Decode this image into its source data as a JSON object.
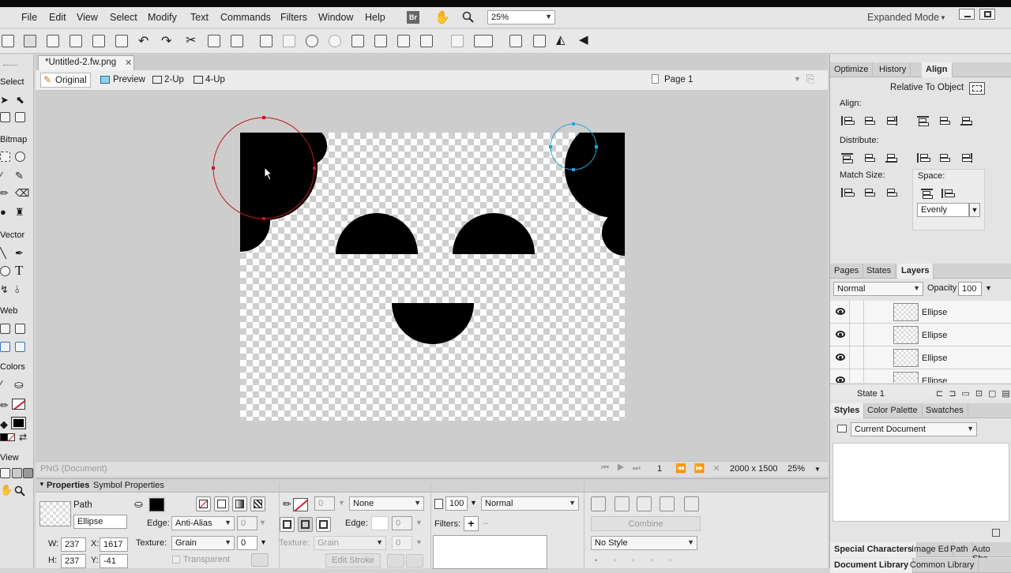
{
  "menubar": {
    "items": [
      "File",
      "Edit",
      "View",
      "Select",
      "Modify",
      "Text",
      "Commands",
      "Filters",
      "Window",
      "Help"
    ],
    "bridge_badge": "Br",
    "zoom": "25%",
    "mode": "Expanded Mode"
  },
  "left_toolbar": {
    "sections": [
      "Select",
      "Bitmap",
      "Vector",
      "Web",
      "Colors",
      "View"
    ],
    "text_tool": "T"
  },
  "document": {
    "tab_title": "*Untitled-2.fw.png",
    "views": {
      "original": "Original",
      "preview": "Preview",
      "two_up": "2-Up",
      "four_up": "4-Up"
    },
    "page": "Page 1",
    "status_type": "PNG (Document)",
    "page_number": "1",
    "dimensions": "2000 x 1500",
    "zoom": "25%"
  },
  "properties": {
    "tabs": [
      "Properties",
      "Symbol Properties"
    ],
    "object_type": "Path",
    "object_name": "Ellipse",
    "fill_edge_label": "Edge:",
    "fill_edge_value": "Anti-Alias",
    "fill_edge_amount": "0",
    "texture_label": "Texture:",
    "texture_value": "Grain",
    "texture_amount": "0",
    "transparent_label": "Transparent",
    "stroke_size": "0",
    "stroke_category": "None",
    "stroke_edge_label": "Edge:",
    "stroke_edge_amount": "0",
    "stroke_texture_label": "Texture:",
    "stroke_texture_value": "Grain",
    "stroke_texture_amount": "0",
    "edit_stroke": "Edit Stroke",
    "opacity": "100",
    "blend_mode": "Normal",
    "filters_label": "Filters:",
    "combine": "Combine",
    "style": "No Style",
    "w_label": "W:",
    "w_value": "237",
    "h_label": "H:",
    "h_value": "237",
    "x_label": "X:",
    "x_value": "1617",
    "y_label": "Y:",
    "y_value": "-41"
  },
  "align_panel": {
    "tabs": [
      "Optimize",
      "History",
      "Align"
    ],
    "relative_to": "Relative To Object",
    "align_label": "Align:",
    "distribute_label": "Distribute:",
    "match_size_label": "Match Size:",
    "space_label": "Space:",
    "space_value": "Evenly"
  },
  "layers_panel": {
    "tabs": [
      "Pages",
      "States",
      "Layers"
    ],
    "blend": "Normal",
    "opacity_label": "Opacity",
    "opacity_value": "100",
    "layers": [
      "Ellipse",
      "Ellipse",
      "Ellipse",
      "Ellipse"
    ],
    "state": "State 1"
  },
  "styles_panel": {
    "tabs": [
      "Styles",
      "Color Palette",
      "Swatches"
    ],
    "library": "Current Document"
  },
  "bottom_tabs": {
    "row1": [
      "Special Characters",
      "Image Ed",
      "Path",
      "Auto Sha"
    ],
    "row2": [
      "Document Library",
      "Common Library"
    ]
  },
  "colors": {
    "accent_selection": "#c0182b",
    "secondary_selection": "#2aa4d8",
    "shape_fill": "#000000"
  }
}
